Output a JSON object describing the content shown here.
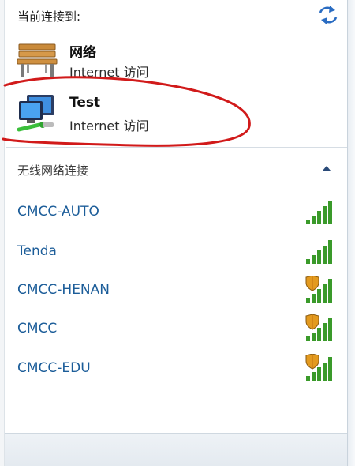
{
  "header": {
    "current_connected_label": "当前连接到:"
  },
  "connections": [
    {
      "name": "网络",
      "status": "Internet 访问",
      "icon": "bench-network-icon"
    },
    {
      "name": "Test",
      "status": "Internet 访问",
      "icon": "computer-network-icon"
    }
  ],
  "wireless": {
    "section_title": "无线网络连接",
    "networks": [
      {
        "ssid": "CMCC-AUTO",
        "secured": false,
        "signal_bars": 5
      },
      {
        "ssid": "Tenda",
        "secured": false,
        "signal_bars": 5
      },
      {
        "ssid": "CMCC-HENAN",
        "secured": true,
        "signal_bars": 5
      },
      {
        "ssid": "CMCC",
        "secured": true,
        "signal_bars": 5
      },
      {
        "ssid": "CMCC-EDU",
        "secured": true,
        "signal_bars": 5
      }
    ]
  },
  "colors": {
    "link_blue": "#1c5d99",
    "signal_green": "#3a9a2a",
    "annotation_red": "#d11a1a",
    "shield_orange": "#e39a1f"
  }
}
